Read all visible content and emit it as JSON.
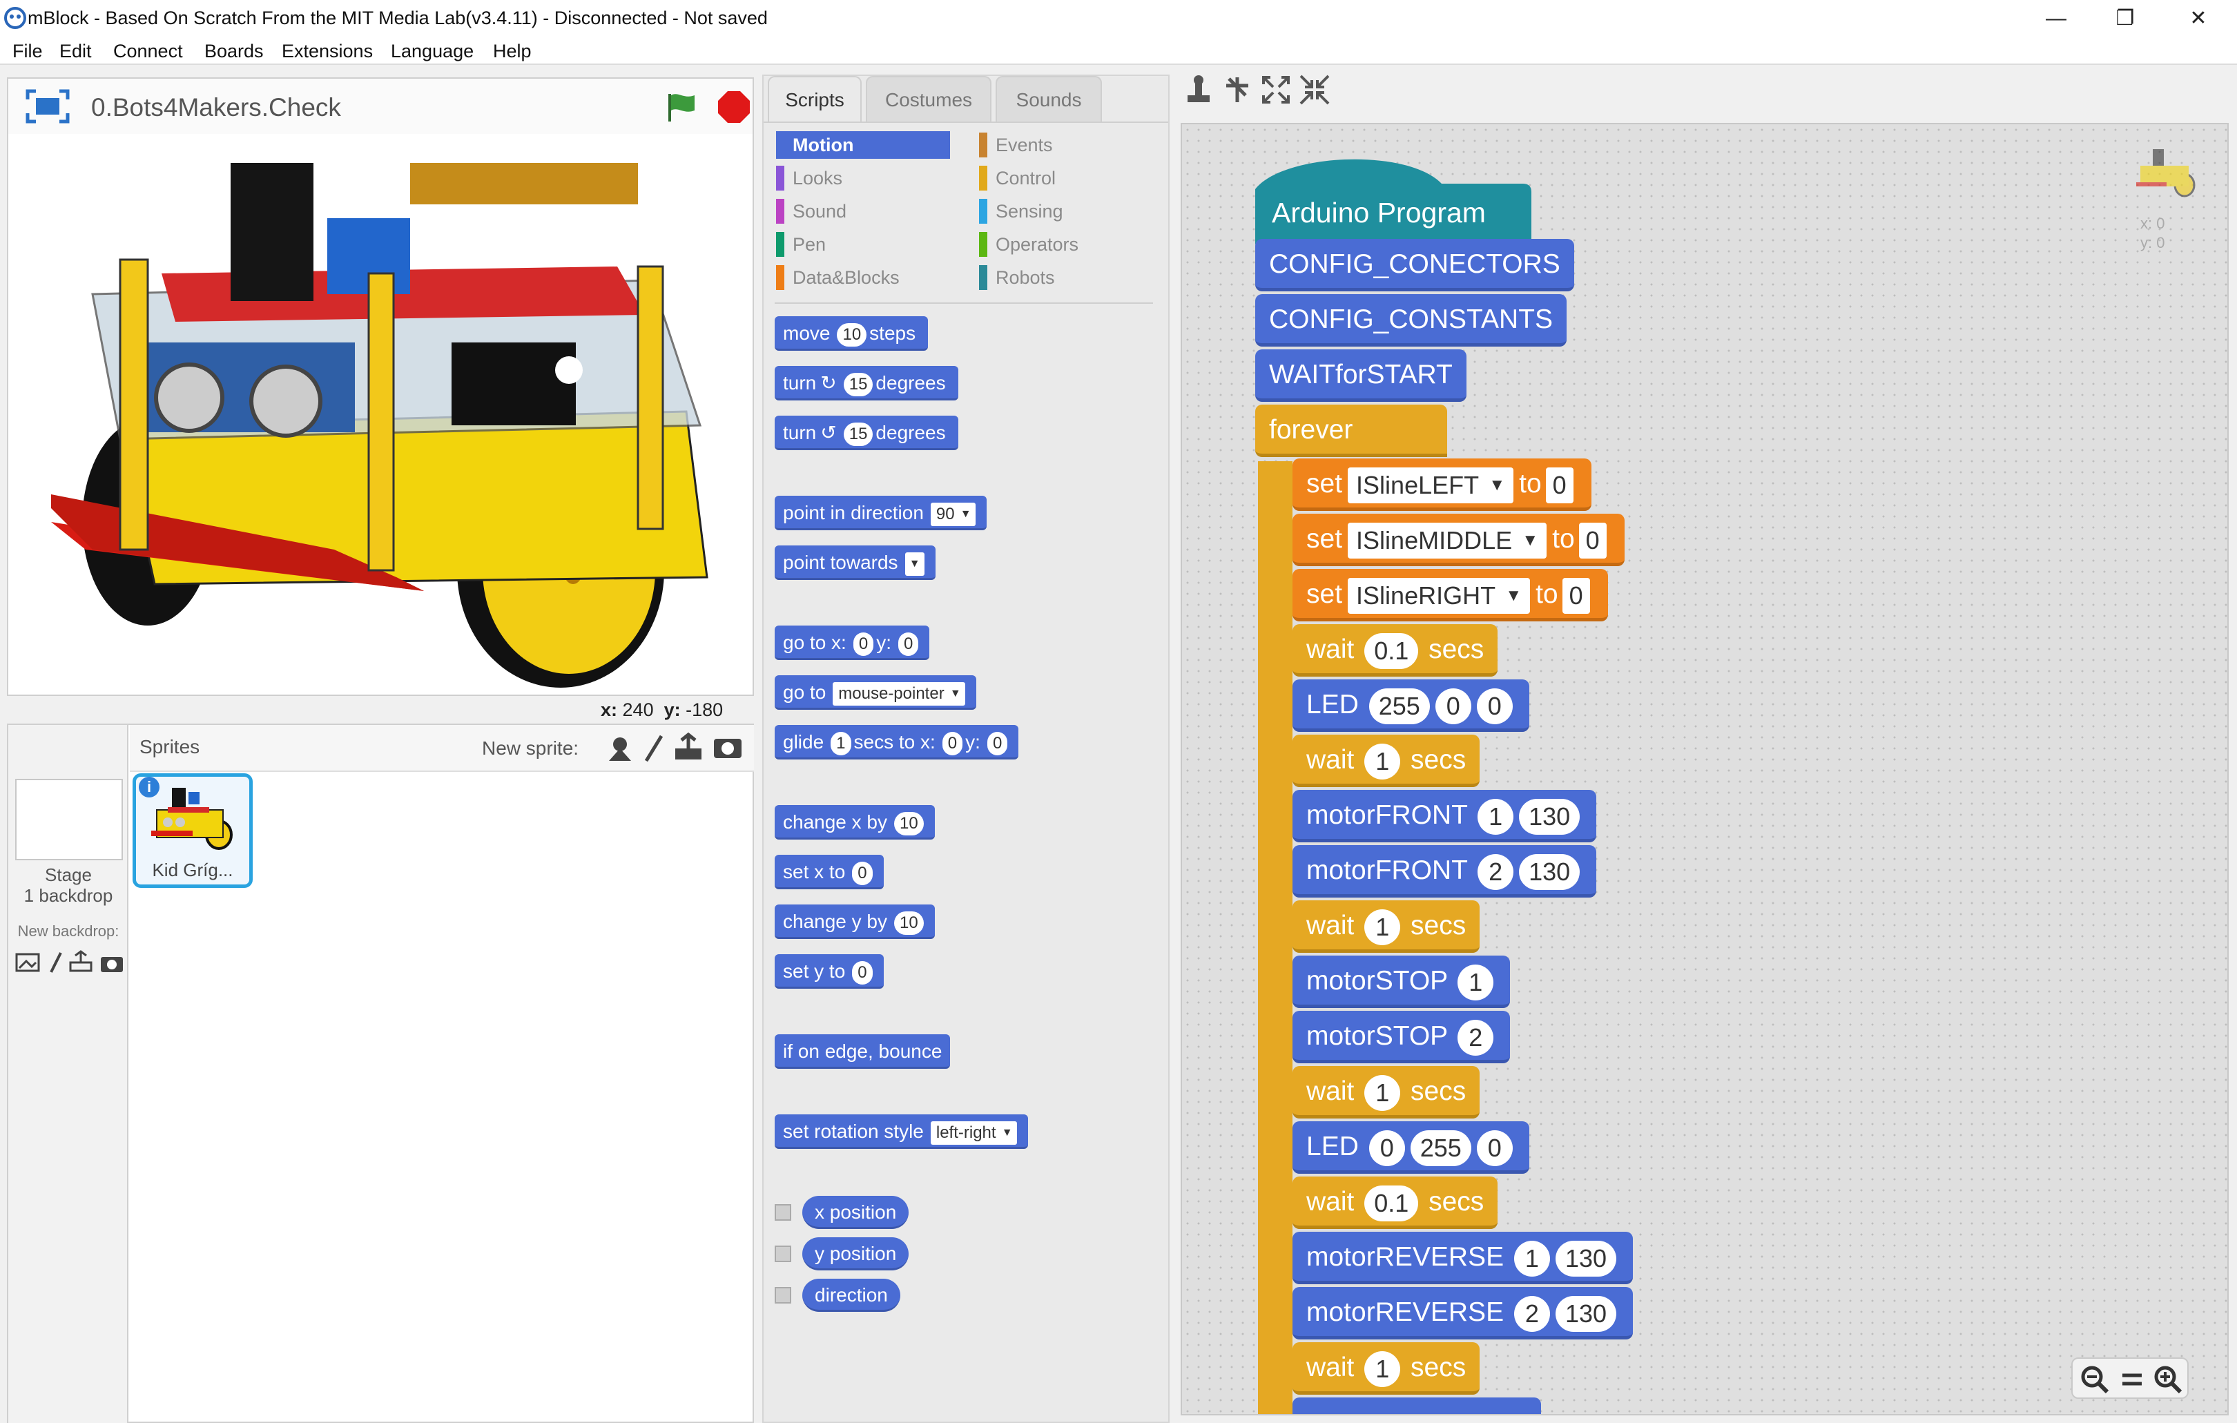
{
  "window": {
    "title": "mBlock - Based On Scratch From the MIT Media Lab(v3.4.11) - Disconnected - Not saved",
    "minimize": "—",
    "restore": "❐",
    "close": "✕"
  },
  "menu": [
    "File",
    "Edit",
    "Connect",
    "Boards",
    "Extensions",
    "Language",
    "Help"
  ],
  "stage": {
    "project_name": "0.Bots4Makers.Check",
    "coords": {
      "x_label": "x:",
      "x": "240",
      "y_label": "y:",
      "y": "-180"
    }
  },
  "sprites": {
    "header": "Sprites",
    "new_sprite": "New sprite:",
    "stage_label": "Stage",
    "stage_backdrops": "1 backdrop",
    "new_backdrop": "New backdrop:",
    "items": [
      {
        "name": "Kid Gríg..."
      }
    ]
  },
  "tabs": [
    "Scripts",
    "Costumes",
    "Sounds"
  ],
  "categories": [
    {
      "label": "Motion",
      "color": "#4a6cd4"
    },
    {
      "label": "Looks",
      "color": "#8a55d7"
    },
    {
      "label": "Sound",
      "color": "#bb42c3"
    },
    {
      "label": "Pen",
      "color": "#0e9a6c"
    },
    {
      "label": "Data&Blocks",
      "color": "#ee7d16"
    },
    {
      "label": "Events",
      "color": "#c88330"
    },
    {
      "label": "Control",
      "color": "#e1a91a"
    },
    {
      "label": "Sensing",
      "color": "#2ca5e2"
    },
    {
      "label": "Operators",
      "color": "#5cb712"
    },
    {
      "label": "Robots",
      "color": "#2b8a98"
    }
  ],
  "palette": {
    "move": {
      "a": "move",
      "v": "10",
      "b": "steps"
    },
    "turn_cw": {
      "a": "turn",
      "arrow": "↻",
      "v": "15",
      "b": "degrees"
    },
    "turn_ccw": {
      "a": "turn",
      "arrow": "↺",
      "v": "15",
      "b": "degrees"
    },
    "point_dir": {
      "a": "point in direction",
      "v": "90"
    },
    "point_towards": {
      "a": "point towards"
    },
    "goto_xy": {
      "a": "go to x:",
      "x": "0",
      "b": "y:",
      "y": "0"
    },
    "goto": {
      "a": "go to",
      "v": "mouse-pointer"
    },
    "glide": {
      "a": "glide",
      "v": "1",
      "b": "secs to x:",
      "x": "0",
      "c": "y:",
      "y": "0"
    },
    "change_x": {
      "a": "change x by",
      "v": "10"
    },
    "set_x": {
      "a": "set x to",
      "v": "0"
    },
    "change_y": {
      "a": "change y by",
      "v": "10"
    },
    "set_y": {
      "a": "set y to",
      "v": "0"
    },
    "bounce": "if on edge, bounce",
    "rotation": {
      "a": "set rotation style",
      "v": "left-right"
    },
    "reporters": [
      "x position",
      "y position",
      "direction"
    ]
  },
  "script_coords": {
    "x": "x: 0",
    "y": "y: 0"
  },
  "script": {
    "hat": "Arduino  Program",
    "config_conectors": "CONFIG_CONECTORS",
    "config_constants": "CONFIG_CONSTANTS",
    "wait_start": "WAITforSTART",
    "forever": "forever",
    "set_left": {
      "a": "set",
      "var": "ISlineLEFT",
      "b": "to",
      "v": "0"
    },
    "set_middle": {
      "a": "set",
      "var": "ISlineMIDDLE",
      "b": "to",
      "v": "0"
    },
    "set_right": {
      "a": "set",
      "var": "ISlineRIGHT",
      "b": "to",
      "v": "0"
    },
    "wait1": {
      "a": "wait",
      "v": "0.1",
      "b": "secs"
    },
    "led1": {
      "a": "LED",
      "r": "255",
      "g": "0",
      "bl": "0"
    },
    "wait2": {
      "a": "wait",
      "v": "1",
      "b": "secs"
    },
    "mf1": {
      "a": "motorFRONT",
      "m": "1",
      "s": "130"
    },
    "mf2": {
      "a": "motorFRONT",
      "m": "2",
      "s": "130"
    },
    "wait3": {
      "a": "wait",
      "v": "1",
      "b": "secs"
    },
    "ms1": {
      "a": "motorSTOP",
      "m": "1"
    },
    "ms2": {
      "a": "motorSTOP",
      "m": "2"
    },
    "wait4": {
      "a": "wait",
      "v": "1",
      "b": "secs"
    },
    "led2": {
      "a": "LED",
      "r": "0",
      "g": "255",
      "bl": "0"
    },
    "wait5": {
      "a": "wait",
      "v": "0.1",
      "b": "secs"
    },
    "mr1": {
      "a": "motorREVERSE",
      "m": "1",
      "s": "130"
    },
    "mr2": {
      "a": "motorREVERSE",
      "m": "2",
      "s": "130"
    },
    "wait6": {
      "a": "wait",
      "v": "1",
      "b": "secs"
    }
  },
  "zoom": {
    "out": "−",
    "reset": "=",
    "in": "+"
  }
}
